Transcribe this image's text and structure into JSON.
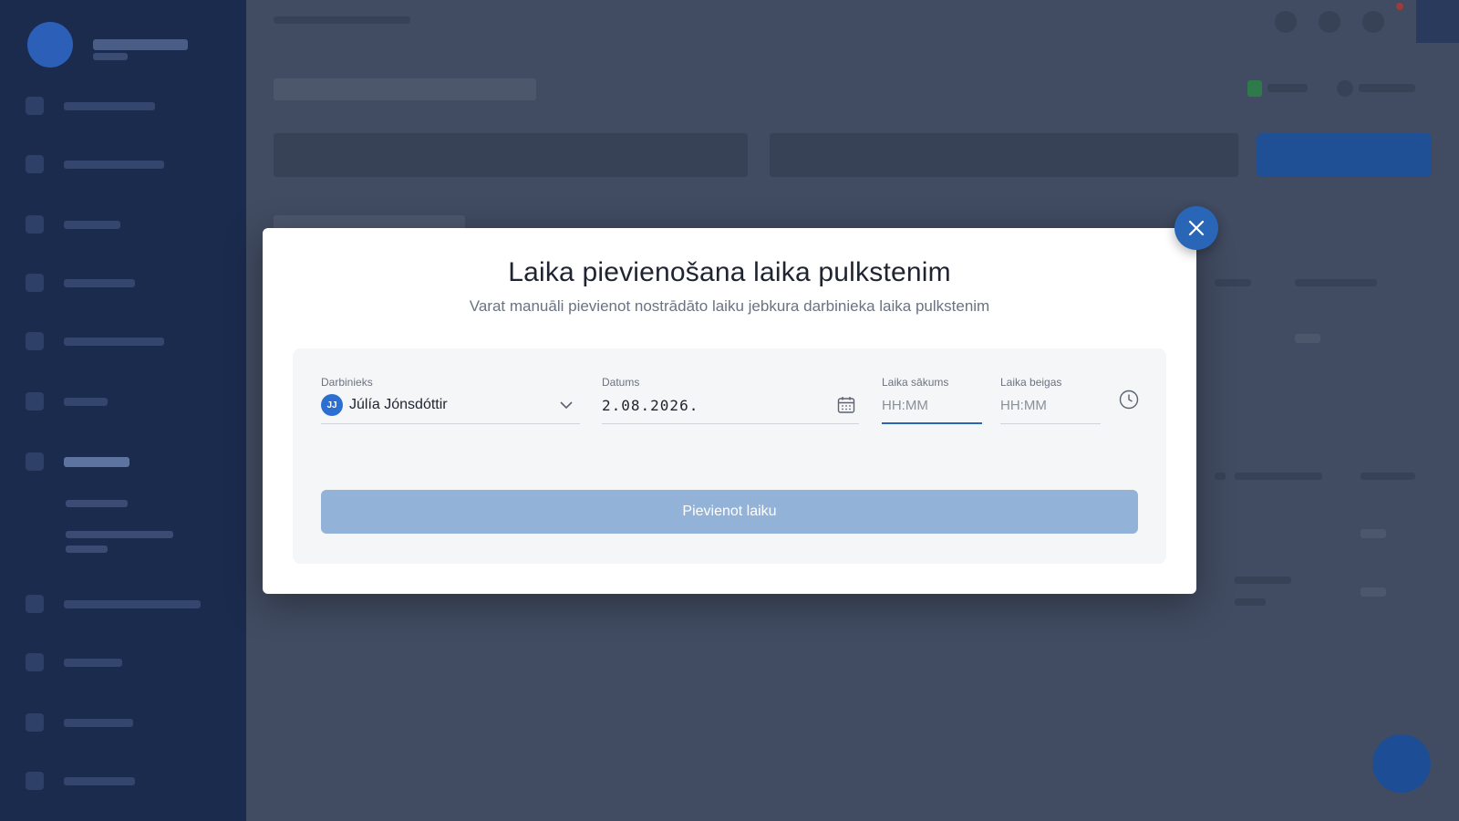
{
  "modal": {
    "title": "Laika pievienošana laika pulkstenim",
    "subtitle": "Varat manuāli pievienot nostrādāto laiku jebkura darbinieka laika pulkstenim",
    "employee": {
      "label": "Darbinieks",
      "initials": "JJ",
      "value": "Júlía Jónsdóttir"
    },
    "date": {
      "label": "Datums",
      "value": "2.08.2026."
    },
    "start_time": {
      "label": "Laika sākums",
      "placeholder": "HH:MM"
    },
    "end_time": {
      "label": "Laika beigas",
      "placeholder": "HH:MM"
    },
    "submit_label": "Pievienot laiku"
  },
  "colors": {
    "accent": "#2a66b7",
    "button_disabled": "#93b2d8",
    "overlay_sidebar": "#1b2b4e",
    "overlay_main": "#414b61"
  },
  "icons": [
    "close-icon",
    "chevron-down-icon",
    "calendar-icon",
    "clock-icon"
  ]
}
